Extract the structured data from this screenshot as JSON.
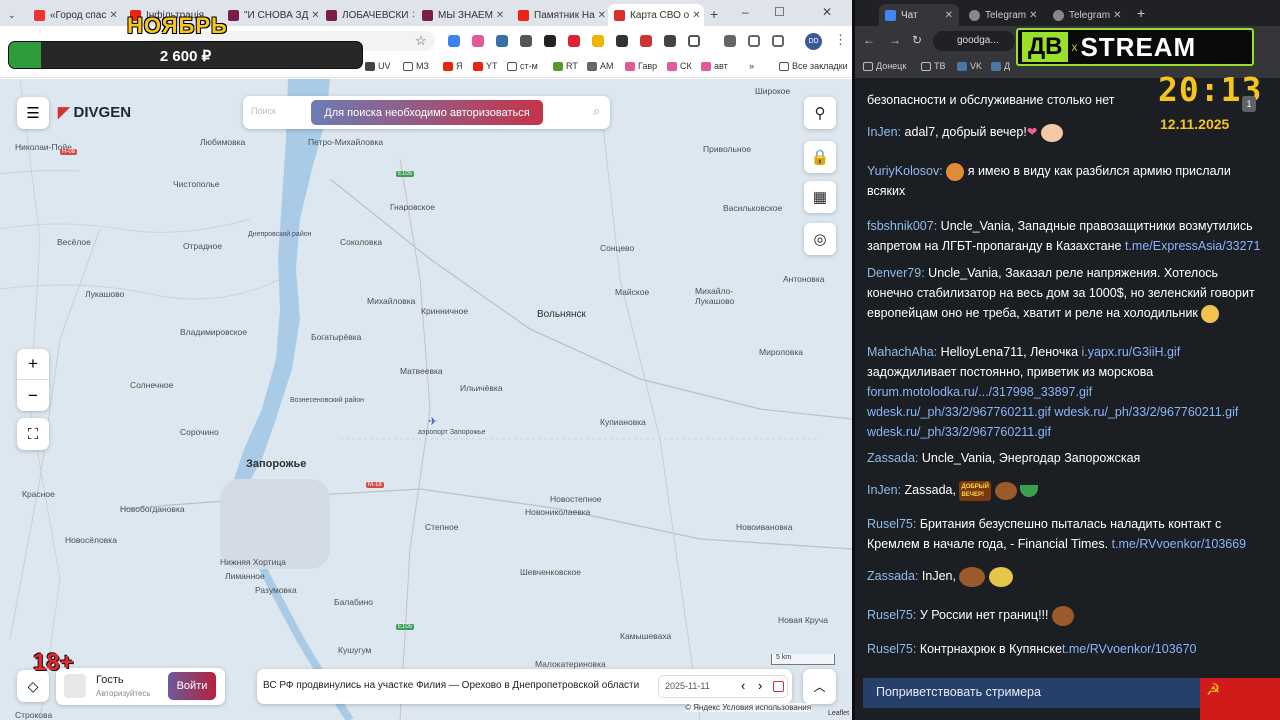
{
  "left_browser": {
    "tabs": [
      {
        "label": "«Город спас"
      },
      {
        "label": "Інфільтрація"
      },
      {
        "label": "\"И СНОВА ЗД"
      },
      {
        "label": "ЛОБАЧЕВСКИ"
      },
      {
        "label": "МЫ ЗНАЕМ"
      },
      {
        "label": "Памятник На"
      },
      {
        "label": "Карта СВО о"
      }
    ],
    "new_tab": "+",
    "bookmarks": [
      "UV",
      "МЗ",
      "Я",
      "YT",
      "ст-м",
      "RT",
      "AM",
      "Гавр",
      "СК",
      "авт"
    ],
    "more_bookmarks": "»",
    "all_bookmarks": "Все закладки",
    "profile_initials": "DD",
    "window_controls": [
      "–",
      "☐",
      "✕"
    ]
  },
  "overlay": {
    "month": "НОЯБРЬ",
    "donation_amount": "2 600 ₽",
    "donation_progress": 0.09,
    "age_rating": "18+"
  },
  "map": {
    "brand": "DIVGEN",
    "search_placeholder": "Поиск",
    "auth_required": "Для поиска необходимо авторизоваться",
    "zoom_in": "+",
    "zoom_out": "−",
    "user_name": "Гость",
    "user_status": "Авторизуйтесь",
    "login_button": "Войти",
    "news_text": "ВС РФ продвинулись на участке Филия — Орехово в Днепропетровской области",
    "date": "2025-11-11",
    "prev": "‹",
    "next": "›",
    "scale": "5 km",
    "attribution": "© Яндекс Условия использования",
    "leaflet": "Leaflet",
    "city": "Запорожье",
    "places": [
      {
        "name": "Николаи-Пойе"
      },
      {
        "name": "Петро-Михайловка"
      },
      {
        "name": "Любимовка"
      },
      {
        "name": "Привольное"
      },
      {
        "name": "Чистополье"
      },
      {
        "name": "Гнаровское"
      },
      {
        "name": "Васильковское"
      },
      {
        "name": "Весёлое"
      },
      {
        "name": "Отрадное"
      },
      {
        "name": "Соколовка"
      },
      {
        "name": "Днепровский район"
      },
      {
        "name": "Сонцево"
      },
      {
        "name": "Антоновка"
      },
      {
        "name": "Лукашово"
      },
      {
        "name": "Михайловка"
      },
      {
        "name": "Майское"
      },
      {
        "name": "Михайло-Лукашово"
      },
      {
        "name": "Кринничное"
      },
      {
        "name": "Вольнянск"
      },
      {
        "name": "Владимировское"
      },
      {
        "name": "Богатырёвка"
      },
      {
        "name": "Мироловка"
      },
      {
        "name": "Солнечное"
      },
      {
        "name": "Матвеевка"
      },
      {
        "name": "Вознесеновский район"
      },
      {
        "name": "Ильичёвка"
      },
      {
        "name": "Купиановка"
      },
      {
        "name": "аэропорт Запорожье"
      },
      {
        "name": "Сорочино"
      },
      {
        "name": "Новобогдановка"
      },
      {
        "name": "Красное"
      },
      {
        "name": "Новостепное"
      },
      {
        "name": "Новосёловка"
      },
      {
        "name": "Степное"
      },
      {
        "name": "Новониколаевка"
      },
      {
        "name": "Новоивановка"
      },
      {
        "name": "Нижняя Хортица"
      },
      {
        "name": "Шевченковское"
      },
      {
        "name": "Лиманное"
      },
      {
        "name": "Разумовка"
      },
      {
        "name": "Балабино"
      },
      {
        "name": "Кушугум"
      },
      {
        "name": "Камышеваха"
      },
      {
        "name": "Малокатериновка"
      },
      {
        "name": "Новая Круча"
      },
      {
        "name": "Строкова"
      },
      {
        "name": "Широкое"
      }
    ],
    "roads": [
      "Н-08",
      "E105",
      "M-18",
      "E105"
    ]
  },
  "right_browser": {
    "tabs": [
      {
        "label": "Чат"
      },
      {
        "label": "Telegram"
      },
      {
        "label": "Telegram"
      }
    ],
    "new_tab": "+",
    "url": "goodga...",
    "bookmarks": [
      "Донецк",
      "ТВ",
      "VK",
      "Д"
    ]
  },
  "stream": {
    "logo_left": "ДВ",
    "logo_x": "x",
    "logo_right": "STREAM",
    "time": "20:13",
    "date": "12.11.2025",
    "greet_button": "Поприветствовать стримера"
  },
  "chat": [
    {
      "nick": "",
      "text": "безопасности и обслуживание столько нет",
      "link": ""
    },
    {
      "nick": "InJen:",
      "text": "adal7, добрый вечер!",
      "link": ""
    },
    {
      "nick": "YuriyKolosov:",
      "text": "я имею в виду как разбился армию прислали всяких",
      "link": ""
    },
    {
      "nick": "fsbshnik007:",
      "text": "Uncle_Vania, Западные правозащитники возмутились запретом на ЛГБТ-пропаганду в Казахстане",
      "link": "t.me/ExpressAsia/33271"
    },
    {
      "nick": "Denver79:",
      "text": "Uncle_Vania, Заказал реле напряжения. Хотелось конечно стабилизатор на весь дом за 1000$, но зеленский говорит европейцам оно не треба, хватит и реле на холодильник",
      "link": ""
    },
    {
      "nick": "MahachAha:",
      "text": "HelloyLena711, Леночка",
      "link": "i.yapx.ru/G3iiH.gif",
      "text2": "задождиливает постоянно, приветик из морскова",
      "links2": [
        "forum.motolodka.ru/.../317998_33897.gif",
        "wdesk.ru/_ph/33/2/967760211.gif",
        "wdesk.ru/_ph/33/2/967760211.gif",
        "wdesk.ru/_ph/33/2/967760211.gif"
      ]
    },
    {
      "nick": "Zassada:",
      "text": "Uncle_Vania, Энергодар Запорожская",
      "link": ""
    },
    {
      "nick": "InJen:",
      "text": "Zassada,",
      "link": "",
      "sticker_text": "ДОБРЫЙ ВЕЧЕР!"
    },
    {
      "nick": "Rusel75:",
      "text": "Британия безуспешно пыталась наладить контакт с Кремлем в начале года, - Financial Times.",
      "link": "t.me/RVvoenkor/103669"
    },
    {
      "nick": "Zassada:",
      "text": "InJen,",
      "link": ""
    },
    {
      "nick": "Rusel75:",
      "text": "У России нет границ!!!",
      "link": ""
    },
    {
      "nick": "Rusel75:",
      "text": "Контрнахрюк в Купянске",
      "link": "t.me/RVvoenkor/103670"
    }
  ],
  "colors": {
    "map_bg": "#dde7ef",
    "water": "#a9cbe6",
    "auth_button": "#c5344b",
    "login_button": "#b5223c",
    "chat_bg": "#1b1f24",
    "nick": "#8fbbe9",
    "link": "#8ab4f8",
    "overlay_green": "#2e9c3c",
    "stream_yellow": "#f7c41b"
  }
}
